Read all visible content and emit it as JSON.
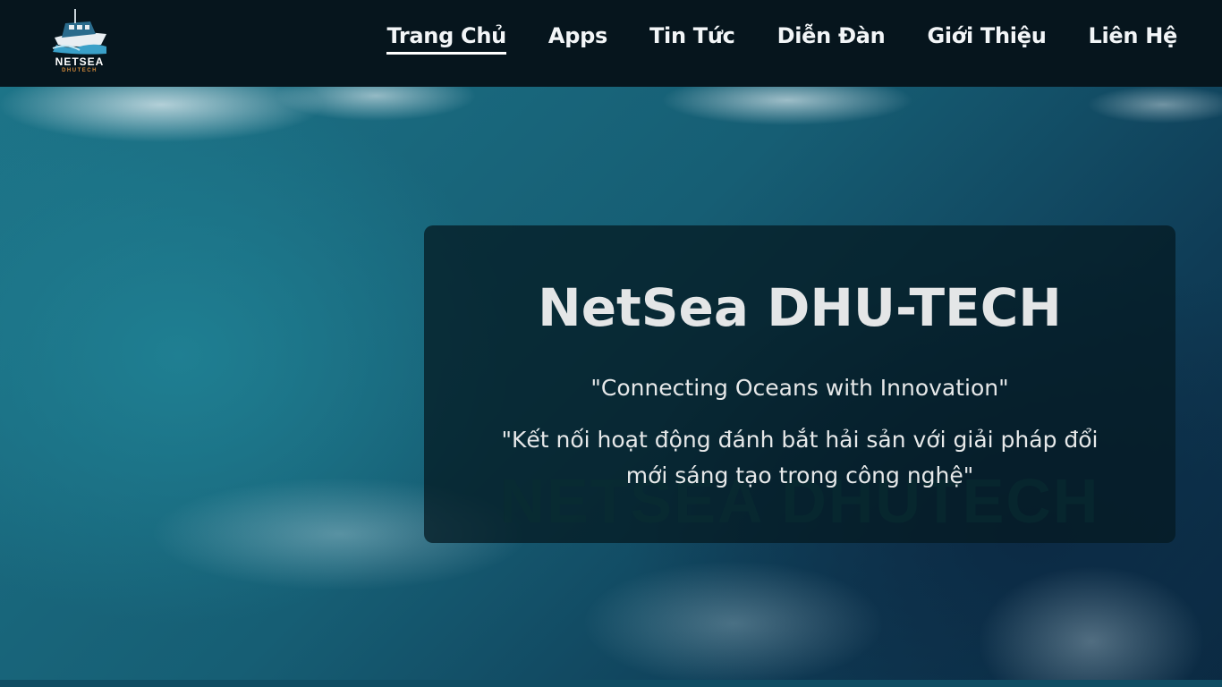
{
  "brand": {
    "name": "NETSEA",
    "subtitle": "DHUTECH"
  },
  "nav": {
    "items": [
      {
        "label": "Trang Chủ",
        "active": true
      },
      {
        "label": "Apps",
        "active": false
      },
      {
        "label": "Tin Tức",
        "active": false
      },
      {
        "label": "Diễn Đàn",
        "active": false
      },
      {
        "label": "Giới Thiệu",
        "active": false
      },
      {
        "label": "Liên Hệ",
        "active": false
      }
    ]
  },
  "hero": {
    "title": "NetSea DHU-TECH",
    "tagline": "\"Connecting Oceans with Innovation\"",
    "description": "\"Kết nối hoạt động đánh bắt hải sản với giải pháp đổi mới sáng tạo trong công nghệ\"",
    "watermark": "NETSEA DHUTECH"
  },
  "colors": {
    "navbar_bg": "#06151d",
    "card_bg": "rgba(4,26,33,0.75)",
    "logo_accent": "#d28a3c"
  }
}
